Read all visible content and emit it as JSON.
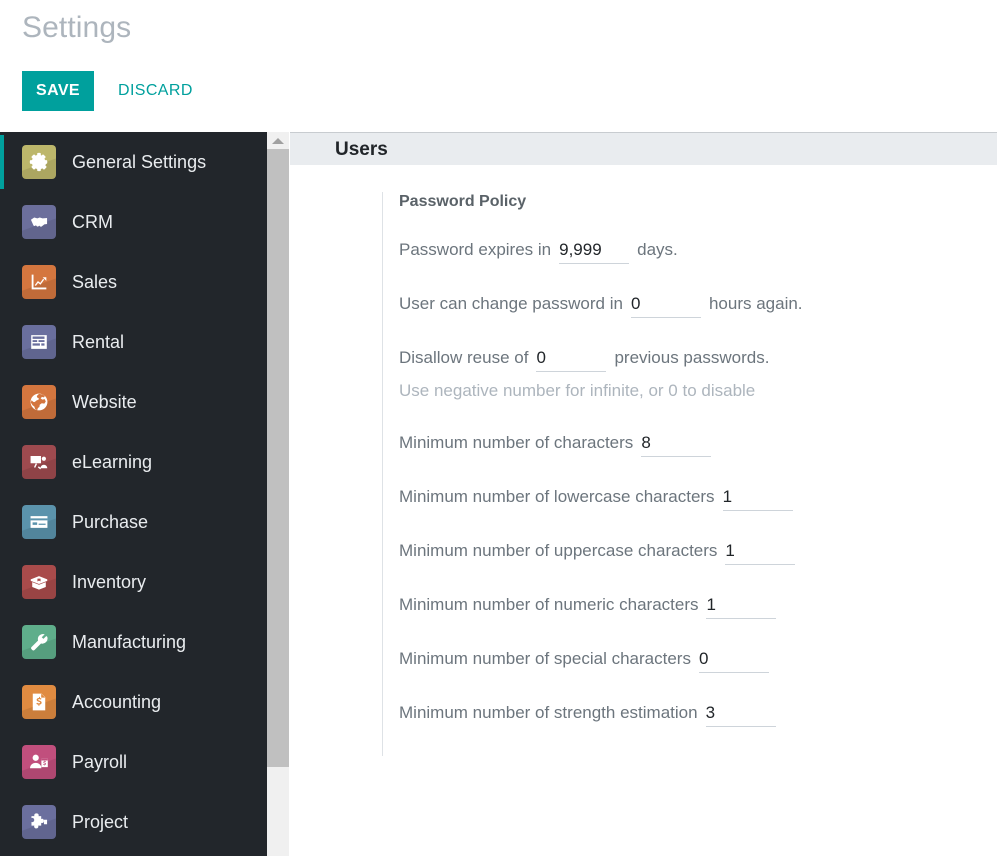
{
  "topbar": {
    "title": "Settings",
    "save_label": "SAVE",
    "discard_label": "DISCARD",
    "accent_color": "#00a09d"
  },
  "sidebar": {
    "items": [
      {
        "label": "General Settings",
        "icon": "gear-icon",
        "color": "#bdb76b",
        "active": true
      },
      {
        "label": "CRM",
        "icon": "handshake-icon",
        "color": "#6c6f9c",
        "active": false
      },
      {
        "label": "Sales",
        "icon": "chart-up-icon",
        "color": "#d4763f",
        "active": false
      },
      {
        "label": "Rental",
        "icon": "calendar-rows-icon",
        "color": "#6a6f9e",
        "active": false
      },
      {
        "label": "Website",
        "icon": "globe-icon",
        "color": "#d4763f",
        "active": false
      },
      {
        "label": "eLearning",
        "icon": "presenter-icon",
        "color": "#9e4a4f",
        "active": false
      },
      {
        "label": "Purchase",
        "icon": "credit-card-icon",
        "color": "#5b93ac",
        "active": false
      },
      {
        "label": "Inventory",
        "icon": "open-box-icon",
        "color": "#a94b4b",
        "active": false
      },
      {
        "label": "Manufacturing",
        "icon": "wrench-icon",
        "color": "#5fae8b",
        "active": false
      },
      {
        "label": "Accounting",
        "icon": "invoice-icon",
        "color": "#e08b41",
        "active": false
      },
      {
        "label": "Payroll",
        "icon": "employee-pay-icon",
        "color": "#c14f7d",
        "active": false
      },
      {
        "label": "Project",
        "icon": "puzzle-icon",
        "color": "#6b6f9e",
        "active": false
      }
    ]
  },
  "scrollbar": {
    "up_arrow": "scroll-up-arrow"
  },
  "main": {
    "section_title": "Users",
    "block_title": "Password Policy",
    "fields": [
      {
        "prefix": "Password expires in",
        "value": "9,999",
        "suffix": "days.",
        "hint": ""
      },
      {
        "prefix": "User can change password in",
        "value": "0",
        "suffix": "hours again.",
        "hint": ""
      },
      {
        "prefix": "Disallow reuse of",
        "value": "0",
        "suffix": "previous passwords.",
        "hint": "Use negative number for infinite, or 0 to disable"
      },
      {
        "prefix": "Minimum number of characters",
        "value": "8",
        "suffix": "",
        "hint": ""
      },
      {
        "prefix": "Minimum number of lowercase characters",
        "value": "1",
        "suffix": "",
        "hint": ""
      },
      {
        "prefix": "Minimum number of uppercase characters",
        "value": "1",
        "suffix": "",
        "hint": ""
      },
      {
        "prefix": "Minimum number of numeric characters",
        "value": "1",
        "suffix": "",
        "hint": ""
      },
      {
        "prefix": "Minimum number of special characters",
        "value": "0",
        "suffix": "",
        "hint": ""
      },
      {
        "prefix": "Minimum number of strength estimation",
        "value": "3",
        "suffix": "",
        "hint": ""
      }
    ]
  }
}
